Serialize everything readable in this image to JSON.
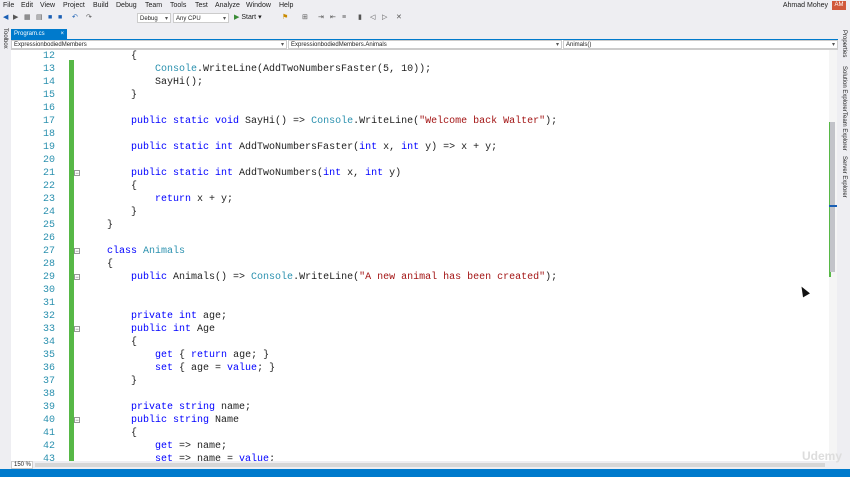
{
  "menu": [
    "File",
    "Edit",
    "View",
    "Project",
    "Build",
    "Debug",
    "Team",
    "Tools",
    "Test",
    "Analyze",
    "Window",
    "Help"
  ],
  "user": {
    "name": "Ahmad Mohey",
    "initials": "AM"
  },
  "toolbar": {
    "config": "Debug",
    "platform": "Any CPU",
    "start_label": "Start"
  },
  "side_panels": {
    "left": "Toolbox",
    "right": [
      "Properties",
      "Solution Explorer",
      "Team Explorer",
      "Server Explorer"
    ]
  },
  "tab": {
    "label": "Program.cs",
    "close": "×"
  },
  "nav": {
    "project": "ExpressionbodiedMembers",
    "type": "ExpressionbodiedMembers.Animals",
    "member": "Animals()"
  },
  "zoom": "150 %",
  "watermark": "Udemy",
  "lines": [
    {
      "n": "12",
      "code": [
        [
          "p",
          "        {"
        ]
      ]
    },
    {
      "n": "13",
      "code": [
        [
          "p",
          "            "
        ],
        [
          "t",
          "Console"
        ],
        [
          "p",
          ".WriteLine(AddTwoNumbersFaster(5, 10));"
        ]
      ]
    },
    {
      "n": "14",
      "code": [
        [
          "p",
          "            SayHi();"
        ]
      ]
    },
    {
      "n": "15",
      "code": [
        [
          "p",
          "        }"
        ]
      ]
    },
    {
      "n": "16",
      "code": []
    },
    {
      "n": "17",
      "code": [
        [
          "p",
          "        "
        ],
        [
          "k",
          "public static void"
        ],
        [
          "p",
          " SayHi() => "
        ],
        [
          "t",
          "Console"
        ],
        [
          "p",
          ".WriteLine("
        ],
        [
          "s",
          "\"Welcome back Walter\""
        ],
        [
          "p",
          ");"
        ]
      ]
    },
    {
      "n": "18",
      "code": []
    },
    {
      "n": "19",
      "code": [
        [
          "p",
          "        "
        ],
        [
          "k",
          "public static int"
        ],
        [
          "p",
          " AddTwoNumbersFaster("
        ],
        [
          "k",
          "int"
        ],
        [
          "p",
          " x, "
        ],
        [
          "k",
          "int"
        ],
        [
          "p",
          " y) => x + y;"
        ]
      ]
    },
    {
      "n": "20",
      "code": []
    },
    {
      "n": "21",
      "code": [
        [
          "p",
          "        "
        ],
        [
          "k",
          "public static int"
        ],
        [
          "p",
          " AddTwoNumbers("
        ],
        [
          "k",
          "int"
        ],
        [
          "p",
          " x, "
        ],
        [
          "k",
          "int"
        ],
        [
          "p",
          " y)"
        ]
      ]
    },
    {
      "n": "22",
      "code": [
        [
          "p",
          "        {"
        ]
      ]
    },
    {
      "n": "23",
      "code": [
        [
          "p",
          "            "
        ],
        [
          "k",
          "return"
        ],
        [
          "p",
          " x + y;"
        ]
      ]
    },
    {
      "n": "24",
      "code": [
        [
          "p",
          "        }"
        ]
      ]
    },
    {
      "n": "25",
      "code": [
        [
          "p",
          "    }"
        ]
      ]
    },
    {
      "n": "26",
      "code": []
    },
    {
      "n": "27",
      "code": [
        [
          "p",
          "    "
        ],
        [
          "k",
          "class"
        ],
        [
          "p",
          " "
        ],
        [
          "t",
          "Animals"
        ]
      ]
    },
    {
      "n": "28",
      "code": [
        [
          "p",
          "    {"
        ]
      ]
    },
    {
      "n": "29",
      "code": [
        [
          "p",
          "        "
        ],
        [
          "k",
          "public"
        ],
        [
          "p",
          " Animals() => "
        ],
        [
          "t",
          "Console"
        ],
        [
          "p",
          ".WriteLine("
        ],
        [
          "s",
          "\"A new animal has been created\""
        ],
        [
          "p",
          ");"
        ]
      ]
    },
    {
      "n": "30",
      "code": []
    },
    {
      "n": "31",
      "code": []
    },
    {
      "n": "32",
      "code": [
        [
          "p",
          "        "
        ],
        [
          "k",
          "private int"
        ],
        [
          "p",
          " age;"
        ]
      ]
    },
    {
      "n": "33",
      "code": [
        [
          "p",
          "        "
        ],
        [
          "k",
          "public int"
        ],
        [
          "p",
          " Age"
        ]
      ]
    },
    {
      "n": "34",
      "code": [
        [
          "p",
          "        {"
        ]
      ]
    },
    {
      "n": "35",
      "code": [
        [
          "p",
          "            "
        ],
        [
          "k",
          "get"
        ],
        [
          "p",
          " { "
        ],
        [
          "k",
          "return"
        ],
        [
          "p",
          " age; }"
        ]
      ]
    },
    {
      "n": "36",
      "code": [
        [
          "p",
          "            "
        ],
        [
          "k",
          "set"
        ],
        [
          "p",
          " { age = "
        ],
        [
          "k",
          "value"
        ],
        [
          "p",
          "; }"
        ]
      ]
    },
    {
      "n": "37",
      "code": [
        [
          "p",
          "        }"
        ]
      ]
    },
    {
      "n": "38",
      "code": []
    },
    {
      "n": "39",
      "code": [
        [
          "p",
          "        "
        ],
        [
          "k",
          "private string"
        ],
        [
          "p",
          " name;"
        ]
      ]
    },
    {
      "n": "40",
      "code": [
        [
          "p",
          "        "
        ],
        [
          "k",
          "public string"
        ],
        [
          "p",
          " Name"
        ]
      ]
    },
    {
      "n": "41",
      "code": [
        [
          "p",
          "        {"
        ]
      ]
    },
    {
      "n": "42",
      "code": [
        [
          "p",
          "            "
        ],
        [
          "k",
          "get"
        ],
        [
          "p",
          " => name;"
        ]
      ]
    },
    {
      "n": "43",
      "code": [
        [
          "p",
          "            "
        ],
        [
          "k",
          "set"
        ],
        [
          "p",
          " => name = "
        ],
        [
          "k",
          "value"
        ],
        [
          "p",
          ";"
        ]
      ]
    }
  ]
}
